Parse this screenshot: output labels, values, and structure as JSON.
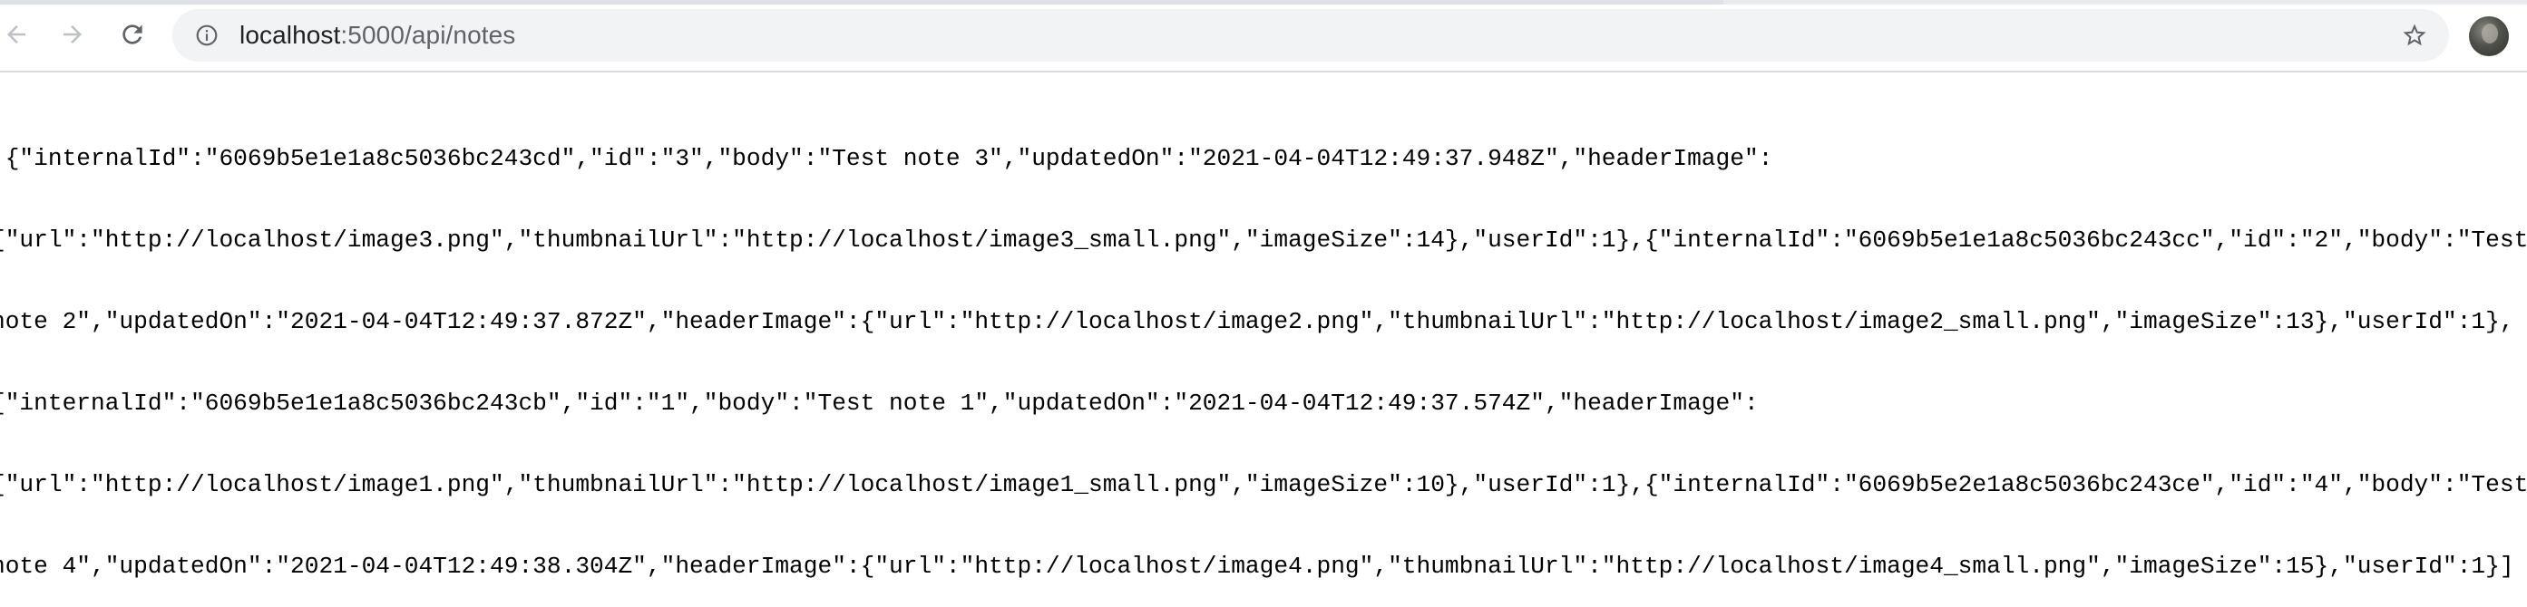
{
  "browser": {
    "address_bar": {
      "host": "localhost",
      "path": ":5000/api/notes"
    },
    "icons": {
      "back": "arrow-left-icon",
      "forward": "arrow-right-icon",
      "reload": "reload-icon",
      "site_info": "info-circle-icon",
      "bookmark": "star-icon",
      "profile": "avatar"
    }
  },
  "page": {
    "lines": [
      " {\"internalId\":\"6069b5e1e1a8c5036bc243cd\",\"id\":\"3\",\"body\":\"Test note 3\",\"updatedOn\":\"2021-04-04T12:49:37.948Z\",\"headerImage\":",
      "{\"url\":\"http://localhost/image3.png\",\"thumbnailUrl\":\"http://localhost/image3_small.png\",\"imageSize\":14},\"userId\":1},{\"internalId\":\"6069b5e1e1a8c5036bc243cc\",\"id\":\"2\",\"body\":\"Test",
      "note 2\",\"updatedOn\":\"2021-04-04T12:49:37.872Z\",\"headerImage\":{\"url\":\"http://localhost/image2.png\",\"thumbnailUrl\":\"http://localhost/image2_small.png\",\"imageSize\":13},\"userId\":1},",
      "{\"internalId\":\"6069b5e1e1a8c5036bc243cb\",\"id\":\"1\",\"body\":\"Test note 1\",\"updatedOn\":\"2021-04-04T12:49:37.574Z\",\"headerImage\":",
      "{\"url\":\"http://localhost/image1.png\",\"thumbnailUrl\":\"http://localhost/image1_small.png\",\"imageSize\":10},\"userId\":1},{\"internalId\":\"6069b5e2e1a8c5036bc243ce\",\"id\":\"4\",\"body\":\"Test",
      "note 4\",\"updatedOn\":\"2021-04-04T12:49:38.304Z\",\"headerImage\":{\"url\":\"http://localhost/image4.png\",\"thumbnailUrl\":\"http://localhost/image4_small.png\",\"imageSize\":15},\"userId\":1}]"
    ]
  }
}
